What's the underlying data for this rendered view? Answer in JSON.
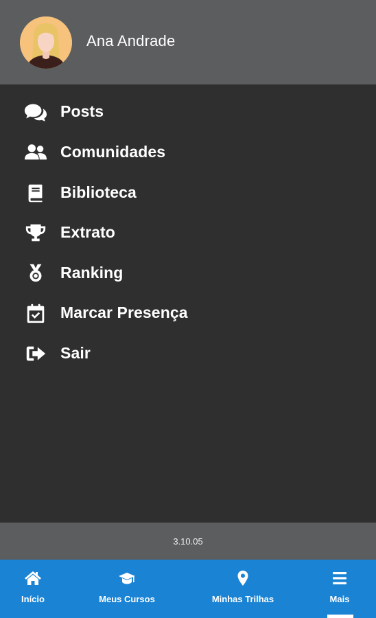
{
  "user": {
    "name": "Ana Andrade",
    "avatar_icon": "woman-avatar-icon"
  },
  "menu": {
    "items": [
      {
        "label": "Posts",
        "icon": "comments-icon"
      },
      {
        "label": "Comunidades",
        "icon": "users-icon"
      },
      {
        "label": "Biblioteca",
        "icon": "book-icon"
      },
      {
        "label": "Extrato",
        "icon": "trophy-icon"
      },
      {
        "label": "Ranking",
        "icon": "medal-icon"
      },
      {
        "label": "Marcar Presença",
        "icon": "calendar-check-icon"
      },
      {
        "label": "Sair",
        "icon": "sign-out-icon"
      }
    ]
  },
  "version": "3.10.05",
  "bottom_nav": {
    "items": [
      {
        "label": "Início",
        "icon": "home-icon"
      },
      {
        "label": "Meus Cursos",
        "icon": "graduation-cap-icon"
      },
      {
        "label": "Minhas Trilhas",
        "icon": "map-marker-icon"
      },
      {
        "label": "Mais",
        "icon": "bars-icon",
        "active": true
      }
    ]
  },
  "colors": {
    "header_bg": "#5c5d5f",
    "menu_bg": "#2f2f2f",
    "nav_bg": "#1a83d4",
    "text": "#ffffff"
  }
}
